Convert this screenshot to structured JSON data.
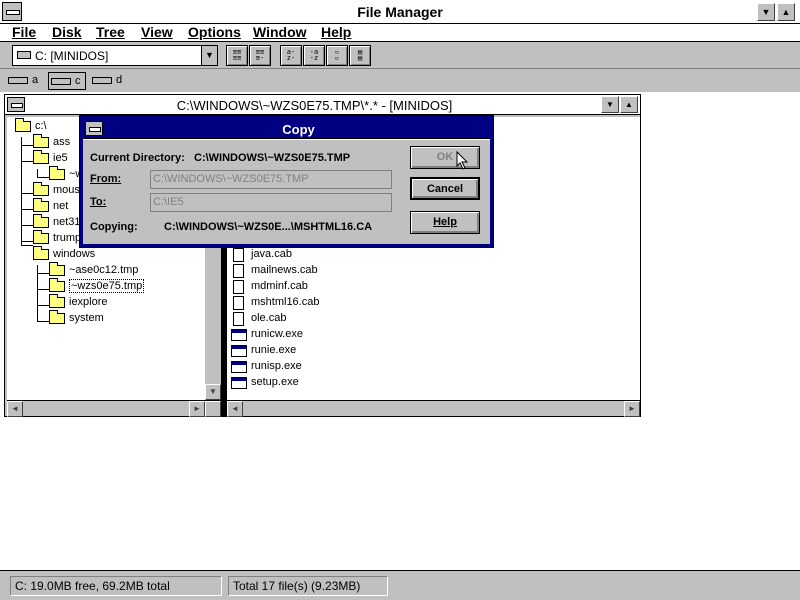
{
  "app": {
    "title": "File Manager"
  },
  "menubar": [
    "File",
    "Disk",
    "Tree",
    "View",
    "Options",
    "Window",
    "Help"
  ],
  "toolbar": {
    "drive_combo": "C: [MINIDOS]",
    "view_buttons": [
      "all-file-details",
      "partial-details",
      "sort-by-name",
      "sort-by-type",
      "sort-by-size",
      "sort-by-date"
    ]
  },
  "drives": [
    {
      "letter": "a",
      "icon": "floppy-drive-icon"
    },
    {
      "letter": "c",
      "icon": "hard-drive-icon"
    },
    {
      "letter": "d",
      "icon": "cdrom-drive-icon"
    }
  ],
  "child_window": {
    "title": "C:\\WINDOWS\\~WZS0E75.TMP\\*.* - [MINIDOS]"
  },
  "tree": [
    {
      "label": "c:\\"
    },
    {
      "label": "ass"
    },
    {
      "label": "ie5"
    },
    {
      "label": "~w"
    },
    {
      "label": "mouse"
    },
    {
      "label": "net"
    },
    {
      "label": "net31"
    },
    {
      "label": "trumpe"
    },
    {
      "label": "windows"
    },
    {
      "label": "~ase0c12.tmp"
    },
    {
      "label": "~wzs0e75.tmp"
    },
    {
      "label": "iexplore"
    },
    {
      "label": "system"
    }
  ],
  "files": [
    {
      "name": "java.cab",
      "type": "doc"
    },
    {
      "name": "mailnews.cab",
      "type": "doc"
    },
    {
      "name": "mdminf.cab",
      "type": "doc"
    },
    {
      "name": "mshtml16.cab",
      "type": "doc"
    },
    {
      "name": "ole.cab",
      "type": "doc"
    },
    {
      "name": "runicw.exe",
      "type": "exe"
    },
    {
      "name": "runie.exe",
      "type": "exe"
    },
    {
      "name": "runisp.exe",
      "type": "exe"
    },
    {
      "name": "setup.exe",
      "type": "exe"
    }
  ],
  "copy_dialog": {
    "title": "Copy",
    "current_dir_label": "Current Directory:",
    "current_dir_value": "C:\\WINDOWS\\~WZS0E75.TMP",
    "from_label": "From:",
    "from_value": "C:\\WINDOWS\\~WZS0E75.TMP",
    "to_label": "To:",
    "to_value": "C:\\IE5",
    "copying_label": "Copying:",
    "copying_value": "C:\\WINDOWS\\~WZS0E...\\MSHTML16.CA",
    "ok_label": "OK",
    "cancel_label": "Cancel",
    "help_label": "Help"
  },
  "status": {
    "left": "C: 19.0MB free,  69.2MB total",
    "right": "Total 17 file(s) (9.23MB)"
  }
}
